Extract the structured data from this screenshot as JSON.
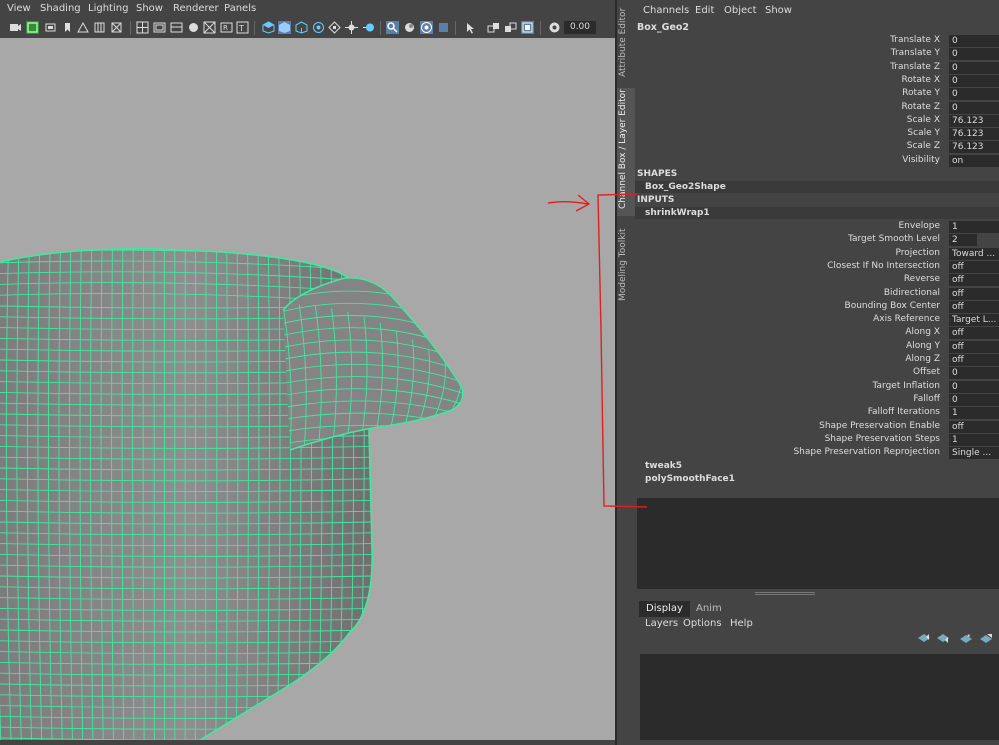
{
  "viewport": {
    "menus": [
      "View",
      "Shading",
      "Lighting",
      "Show",
      "Renderer",
      "Panels"
    ],
    "toolbar": {
      "field_value": "0.00",
      "icons": [
        "camera-icon",
        "film-gate-icon",
        "resolution-gate-icon",
        "bookmark-icon",
        "image-plane-icon",
        "grid-icon",
        "field-chart-icon",
        "safe-action-icon",
        "gate-mask-icon",
        "safe-title-icon",
        "two-d-pan-icon",
        "wireframe-icon",
        "smooth-shade-icon",
        "shaded-wireframe-icon",
        "default-material-icon",
        "xray-icon",
        "lights-icon",
        "shadows-icon",
        "ambient-occlusion-icon",
        "isolate-select-icon",
        "xray-joints-icon",
        "backface-icon",
        "texture-icon",
        "select-camera-icon",
        "component-icon",
        "frame-all-icon",
        "frame-selected-icon",
        "gamma-icon"
      ]
    },
    "mesh_color": "#41e8a3",
    "background_color": "#a8a8a8"
  },
  "side_tabs": [
    "Attribute Editor",
    "Channel Box / Layer Editor",
    "Modeling Toolkit"
  ],
  "channel_box": {
    "menus": [
      "Channels",
      "Edit",
      "Object",
      "Show"
    ],
    "object_name": "Box_Geo2",
    "transform_channels": [
      {
        "label": "Translate X",
        "value": "0"
      },
      {
        "label": "Translate Y",
        "value": "0"
      },
      {
        "label": "Translate Z",
        "value": "0"
      },
      {
        "label": "Rotate X",
        "value": "0"
      },
      {
        "label": "Rotate Y",
        "value": "0"
      },
      {
        "label": "Rotate Z",
        "value": "0"
      },
      {
        "label": "Scale X",
        "value": "76.123"
      },
      {
        "label": "Scale Y",
        "value": "76.123"
      },
      {
        "label": "Scale Z",
        "value": "76.123"
      },
      {
        "label": "Visibility",
        "value": "on"
      }
    ],
    "shapes_header": "SHAPES",
    "shape_node": "Box_Geo2Shape",
    "inputs_header": "INPUTS",
    "input_node": "shrinkWrap1",
    "input_channels": [
      {
        "label": "Envelope",
        "value": "1"
      },
      {
        "label": "Target Smooth Level",
        "value": "2"
      },
      {
        "label": "Projection",
        "value": "Toward ..."
      },
      {
        "label": "Closest If No Intersection",
        "value": "off"
      },
      {
        "label": "Reverse",
        "value": "off"
      },
      {
        "label": "Bidirectional",
        "value": "off"
      },
      {
        "label": "Bounding Box Center",
        "value": "off"
      },
      {
        "label": "Axis Reference",
        "value": "Target L..."
      },
      {
        "label": "Along X",
        "value": "off"
      },
      {
        "label": "Along Y",
        "value": "off"
      },
      {
        "label": "Along Z",
        "value": "off"
      },
      {
        "label": "Offset",
        "value": "0"
      },
      {
        "label": "Target Inflation",
        "value": "0"
      },
      {
        "label": "Falloff",
        "value": "0"
      },
      {
        "label": "Falloff Iterations",
        "value": "1"
      },
      {
        "label": "Shape Preservation Enable",
        "value": "off"
      },
      {
        "label": "Shape Preservation Steps",
        "value": "1"
      },
      {
        "label": "Shape Preservation Reprojection",
        "value": "Single ..."
      }
    ],
    "other_inputs": [
      "tweak5",
      "polySmoothFace1"
    ]
  },
  "layer_editor": {
    "tabs": [
      "Display",
      "Anim"
    ],
    "menus": [
      "Layers",
      "Options",
      "Help"
    ],
    "icons": [
      "move-layer-up-icon",
      "move-layer-down-icon",
      "new-layer-icon",
      "new-layer-from-selected-icon"
    ]
  },
  "annotation_color": "#e02020"
}
